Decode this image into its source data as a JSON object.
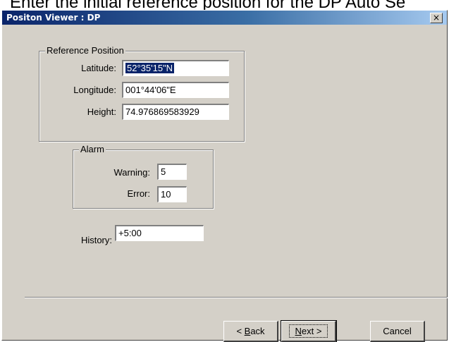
{
  "background_text": "Enter the initial reference position for the DP Auto Se",
  "window": {
    "title": "Positon Viewer : DP",
    "close_glyph": "×"
  },
  "reference_position": {
    "legend": "Reference Position",
    "latitude_label": "Latitude:",
    "latitude_value": "52°35'15\"N",
    "longitude_label": "Longitude:",
    "longitude_value": "001°44'06\"E",
    "height_label": "Height:",
    "height_value": "74.976869583929"
  },
  "alarm": {
    "legend": "Alarm",
    "warning_label": "Warning:",
    "warning_value": "5",
    "error_label": "Error:",
    "error_value": "10"
  },
  "history": {
    "label": "History:",
    "value": "+5:00"
  },
  "buttons": {
    "back_pre": "< ",
    "back_mnemonic": "B",
    "back_post": "ack",
    "next_mnemonic": "N",
    "next_post": "ext >",
    "cancel": "Cancel"
  },
  "colors": {
    "face": "#d4d0c8",
    "title_start": "#0a246a",
    "title_end": "#a6caf0",
    "selection": "#0a246a"
  },
  "icons": {
    "close": "close-icon"
  }
}
